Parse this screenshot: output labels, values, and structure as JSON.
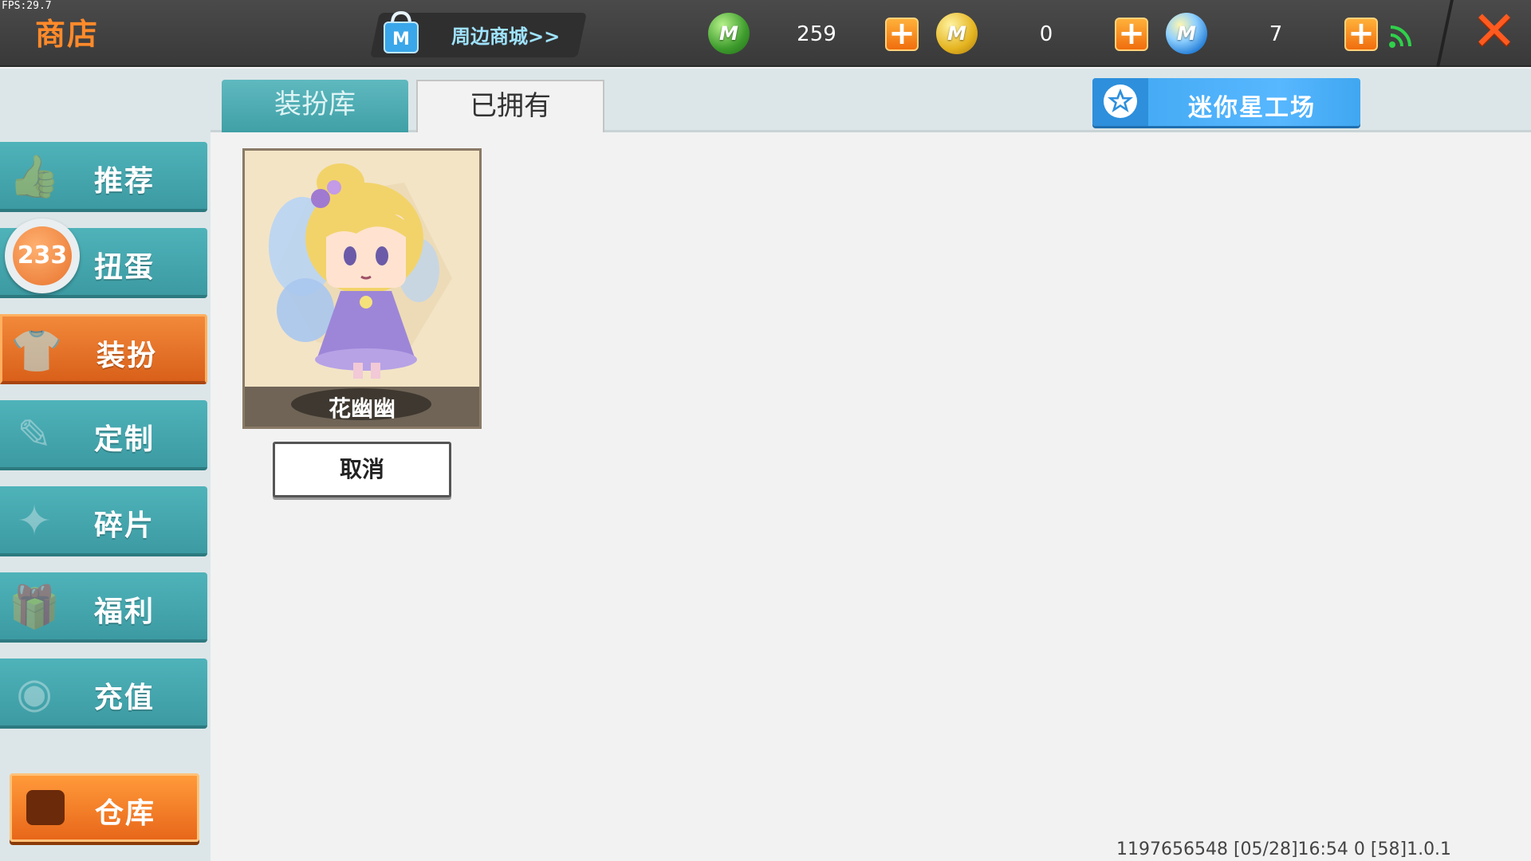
{
  "fps": "FPS:29.7",
  "header": {
    "title": "商店",
    "mall_link": "周边商城>>",
    "currencies": [
      {
        "icon": "green-mini-coin-icon",
        "amount": "259"
      },
      {
        "icon": "gold-mini-coin-icon",
        "amount": "0"
      },
      {
        "icon": "blue-mini-coin-icon",
        "amount": "7"
      }
    ],
    "plus_label": "+",
    "close_label": "✕",
    "coin_letter": "M"
  },
  "sidebar": {
    "items": [
      {
        "label": "推荐",
        "icon": "thumbs-up-icon"
      },
      {
        "label": "扭蛋",
        "icon": "gacha-icon",
        "badge": "233"
      },
      {
        "label": "装扮",
        "icon": "shirt-icon",
        "active": true
      },
      {
        "label": "定制",
        "icon": "brush-icon"
      },
      {
        "label": "碎片",
        "icon": "puzzle-icon"
      },
      {
        "label": "福利",
        "icon": "gift-icon"
      },
      {
        "label": "充值",
        "icon": "coins-icon"
      }
    ],
    "warehouse_label": "仓库"
  },
  "tabs": {
    "library": "装扮库",
    "owned": "已拥有",
    "active": "owned"
  },
  "workshop_label": "迷你星工场",
  "items": [
    {
      "name": "花幽幽",
      "action": "取消"
    }
  ],
  "status_bar": "1197656548   [05/28]16:54 0 [58]1.0.1",
  "colors": {
    "accent_orange": "#e8671a",
    "teal": "#3fa0a6",
    "blue": "#3fa7f0",
    "close_red": "#ff5a1f"
  }
}
